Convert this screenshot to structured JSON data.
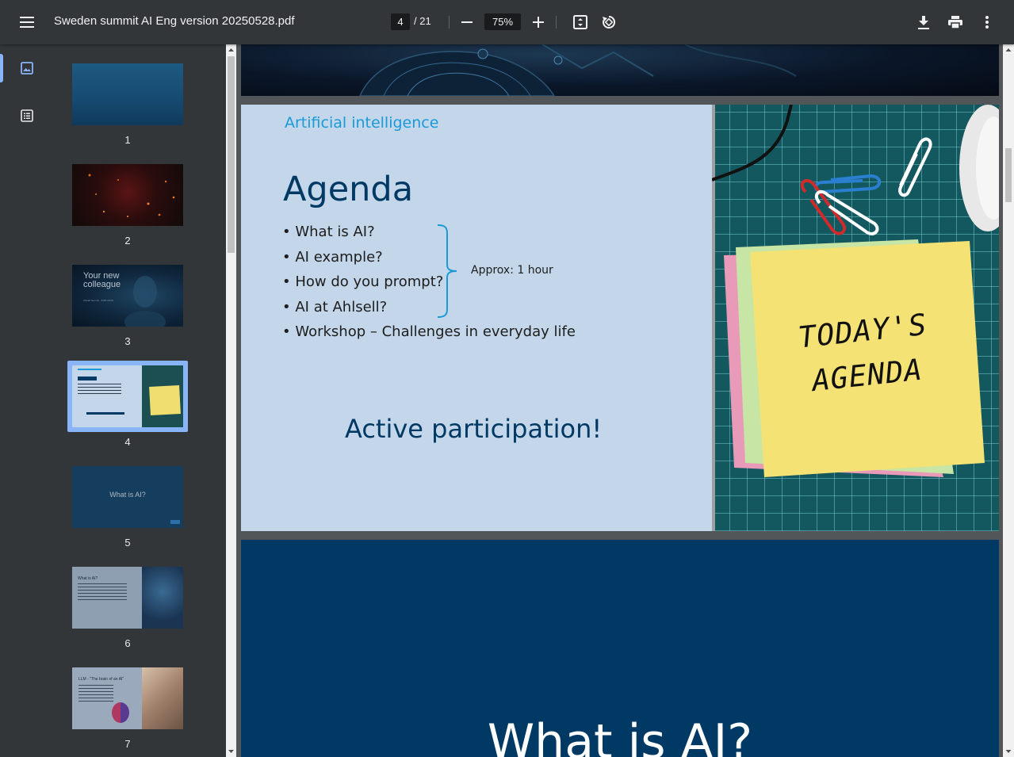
{
  "toolbar": {
    "title": "Sweden summit AI Eng version 20250528.pdf",
    "current_page": "4",
    "total_pages": "/ 21",
    "zoom": "75%"
  },
  "thumbnails": [
    {
      "num": "1"
    },
    {
      "num": "2"
    },
    {
      "num": "3",
      "text": "Your new colleague",
      "sub": "Ahlsell Summit - 2025-06-05"
    },
    {
      "num": "4",
      "selected": true
    },
    {
      "num": "5",
      "text": "What is AI?"
    },
    {
      "num": "6",
      "text": "What is AI?"
    },
    {
      "num": "7",
      "text": "LLM - \"The brain of an AI\""
    }
  ],
  "slide4": {
    "kicker": "Artificial intelligence",
    "title": "Agenda",
    "bullets": [
      "What is AI?",
      "AI example?",
      "How do you prompt?",
      "AI at Ahlsell?",
      "Workshop – Challenges in everyday life"
    ],
    "bracket_note": "Approx: 1 hour",
    "footer": "Active participation!",
    "sticky_line1": "TODAY'S",
    "sticky_line2": "AGENDA"
  },
  "slide5": {
    "title": "What is AI?"
  },
  "colors": {
    "toolbar_bg": "#323639",
    "viewer_bg": "#525659",
    "slide4_bg": "#c3d6ea",
    "kicker": "#1a9ad6",
    "heading": "#003a64",
    "slide5_bg": "#003a64",
    "selection": "#8ab4f8"
  }
}
